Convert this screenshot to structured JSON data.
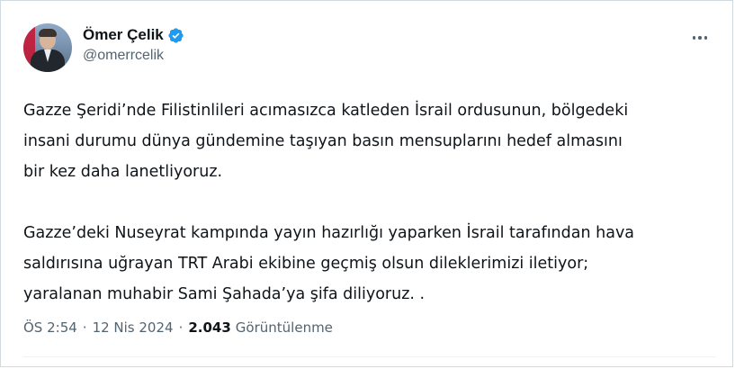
{
  "author": {
    "display_name": "Ömer Çelik",
    "handle": "@omerrcelik",
    "verified_icon": "verified-badge-icon",
    "badge_color": "#1d9bf0"
  },
  "menu": {
    "icon": "more-horizontal-icon"
  },
  "tweet": {
    "paragraph1_lines": [
      "Gazze Şeridi’nde Filistinlileri acımasızca katleden İsrail ordusunun, bölgedeki",
      "insani durumu dünya gündemine taşıyan basın mensuplarını hedef almasını",
      "bir kez daha lanetliyoruz."
    ],
    "paragraph2_lines": [
      "Gazze’deki Nuseyrat kampında yayın hazırlığı yaparken İsrail tarafından hava",
      "saldırısına uğrayan TRT Arabi ekibine geçmiş olsun dileklerimizi iletiyor;",
      "yaralanan muhabir Sami Şahada’ya şifa diliyoruz. ."
    ]
  },
  "meta": {
    "time": "ÖS 2:54",
    "separator": "·",
    "date": "12 Nis 2024",
    "views_count": "2.043",
    "views_label": "Görüntülenme"
  }
}
